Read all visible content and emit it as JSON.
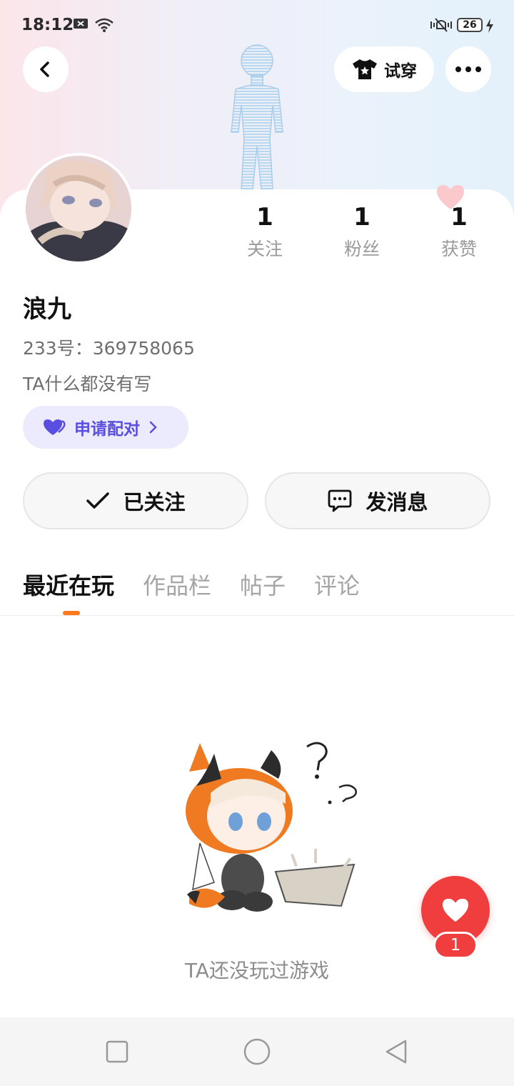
{
  "status_bar": {
    "time": "18:12",
    "battery": "26"
  },
  "header": {
    "try_on_label": "试穿"
  },
  "stats": [
    {
      "value": "1",
      "label": "关注"
    },
    {
      "value": "1",
      "label": "粉丝"
    },
    {
      "value": "1",
      "label": "获赞"
    }
  ],
  "profile": {
    "name": "浪九",
    "uid": "233号：369758065",
    "bio": "TA什么都没有写",
    "pair_label": "申请配对"
  },
  "actions": {
    "follow_label": "已关注",
    "message_label": "发消息"
  },
  "tabs": [
    {
      "label": "最近在玩"
    },
    {
      "label": "作品栏"
    },
    {
      "label": "帖子"
    },
    {
      "label": "评论"
    }
  ],
  "empty_state": {
    "text": "TA还没玩过游戏"
  },
  "fab": {
    "badge": "1"
  },
  "colors": {
    "accent": "#ff7a1a",
    "pair_bg": "#ecebfd",
    "pair_text": "#5a4ee0",
    "fab": "#f03d3d"
  }
}
